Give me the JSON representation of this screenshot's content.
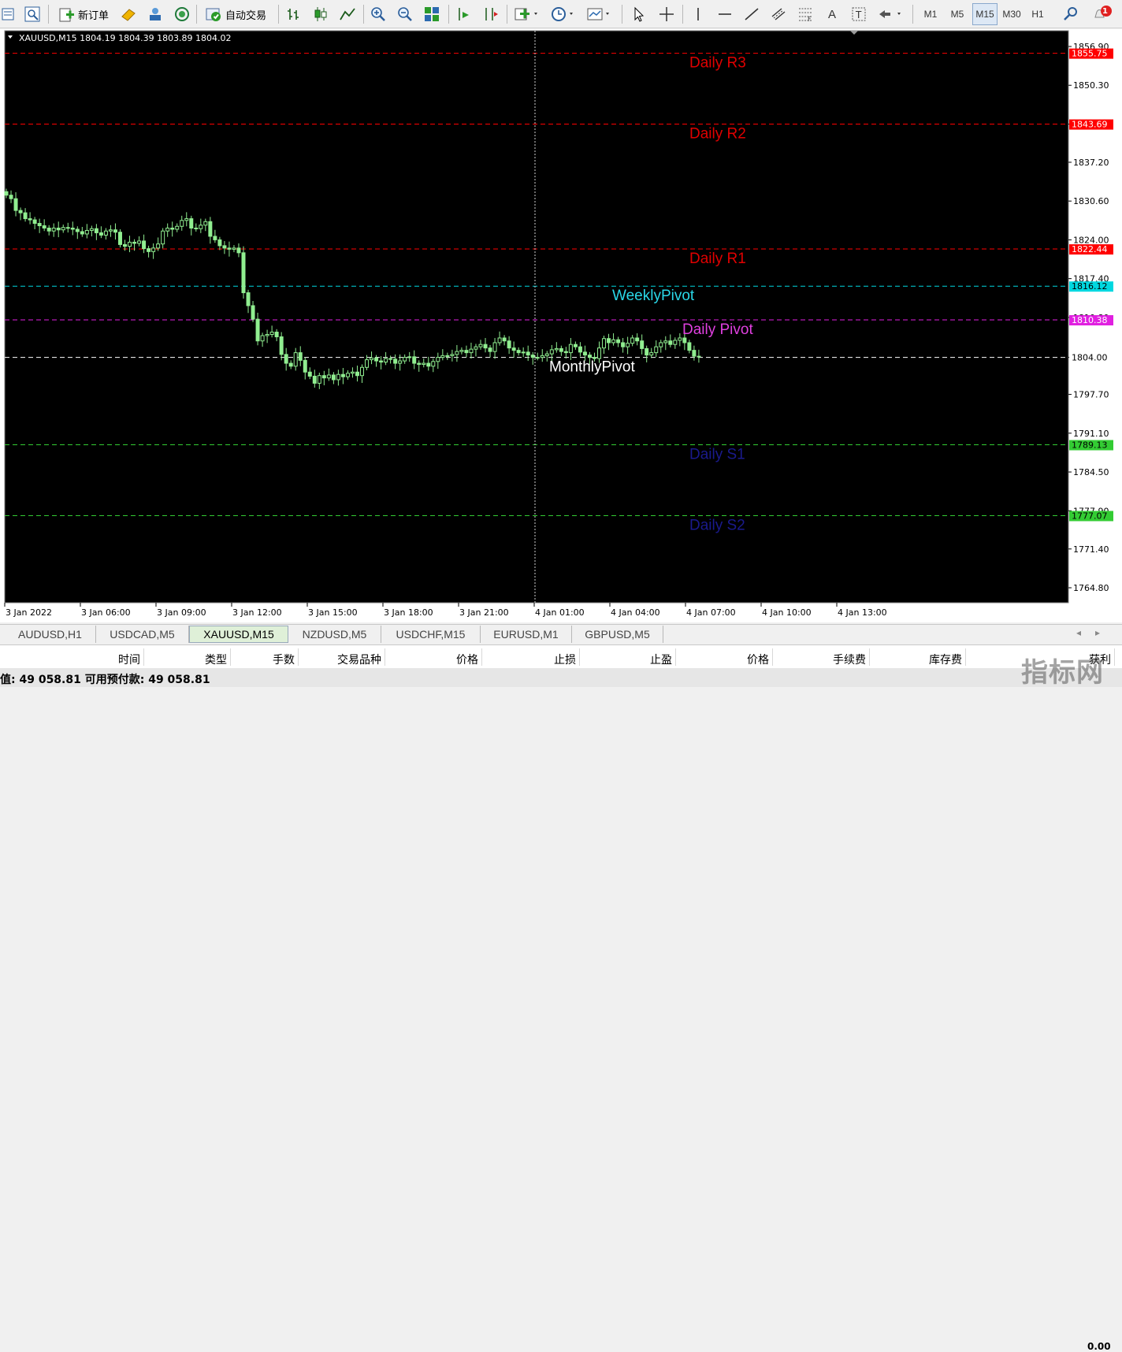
{
  "toolbar": {
    "new_order_label": "新订单",
    "auto_trade_label": "自动交易",
    "timeframes": [
      "M1",
      "M5",
      "M15",
      "M30",
      "H1"
    ],
    "active_timeframe": "M15",
    "text_tool_label": "A",
    "notification_count": "1"
  },
  "chart": {
    "header": "XAUUSD,M15  1804.19 1804.39 1803.89 1804.02",
    "price_ticks": [
      "1856.90",
      "1850.30",
      "1843.69",
      "1837.20",
      "1830.60",
      "1824.00",
      "1817.40",
      "1810.80",
      "1804.00",
      "1797.70",
      "1791.10",
      "1784.50",
      "1777.90",
      "1771.40",
      "1764.80"
    ],
    "time_ticks": [
      "3 Jan 2022",
      "3 Jan 06:00",
      "3 Jan 09:00",
      "3 Jan 12:00",
      "3 Jan 15:00",
      "3 Jan 18:00",
      "3 Jan 21:00",
      "4 Jan 01:00",
      "4 Jan 04:00",
      "4 Jan 07:00",
      "4 Jan 10:00",
      "4 Jan 13:00"
    ],
    "levels": [
      {
        "name": "Daily R3",
        "price": "1855.75",
        "color": "#ff0000",
        "label_color": "#e00000",
        "tag_text_color": "#ffffff",
        "dash": "solid-dash"
      },
      {
        "name": "Daily R2",
        "price": "1843.69",
        "color": "#ff0000",
        "label_color": "#e00000",
        "tag_text_color": "#ffffff"
      },
      {
        "name": "Daily R1",
        "price": "1822.44",
        "color": "#ff0000",
        "label_color": "#e00000",
        "tag_text_color": "#ffffff"
      },
      {
        "name": "WeeklyPivot",
        "price": "1816.12",
        "color": "#00d8e0",
        "label_color": "#2ad8e8",
        "tag_text_color": "#000000"
      },
      {
        "name": "Daily Pivot",
        "price": "1810.38",
        "color": "#e020e0",
        "label_color": "#e040e0",
        "tag_text_color": "#ffffff"
      },
      {
        "name": "MonthlyPivot",
        "price": "1804.00",
        "color": "#ffffff",
        "label_color": "#ffffff",
        "tag_text_color": "#000000"
      },
      {
        "name": "Daily S1",
        "price": "1789.13",
        "color": "#33cc33",
        "label_color": "#1a1a8c",
        "tag_text_color": "#000000"
      },
      {
        "name": "Daily S2",
        "price": "1777.07",
        "color": "#33cc33",
        "label_color": "#1a1a8c",
        "tag_text_color": "#000000"
      }
    ],
    "candle_color": "#90ee90",
    "background": "#000000"
  },
  "symbol_tabs": [
    "AUDUSD,H1",
    "USDCAD,M5",
    "XAUUSD,M15",
    "NZDUSD,M5",
    "USDCHF,M15",
    "EURUSD,M1",
    "GBPUSD,M5"
  ],
  "active_tab": "XAUUSD,M15",
  "terminal": {
    "columns": [
      "时间",
      "类型",
      "手数",
      "交易品种",
      "价格",
      "止损",
      "止盈",
      "价格",
      "手续费",
      "库存费",
      "获利"
    ]
  },
  "status": {
    "text": "值: 49 058.81  可用预付款: 49 058.81",
    "corner_value": "0.00"
  },
  "watermark": "指标网"
}
